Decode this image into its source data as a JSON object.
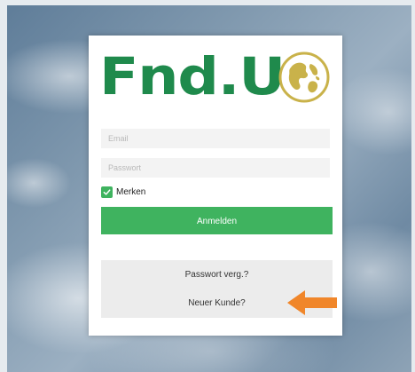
{
  "logo": {
    "text": "Fnd.U",
    "color": "#1f8a4c",
    "globe_icon": "globe-icon",
    "globe_color": "#c9b24a"
  },
  "form": {
    "email_placeholder": "Email",
    "password_placeholder": "Passwort",
    "remember_label": "Merken",
    "remember_checked": true,
    "login_label": "Anmelden",
    "accent_color": "#3fb35f"
  },
  "links": {
    "forgot_password": "Passwort verg.?",
    "new_customer": "Neuer Kunde?"
  },
  "annotation": {
    "arrow_icon": "arrow-left-icon",
    "arrow_color": "#f0862a"
  }
}
